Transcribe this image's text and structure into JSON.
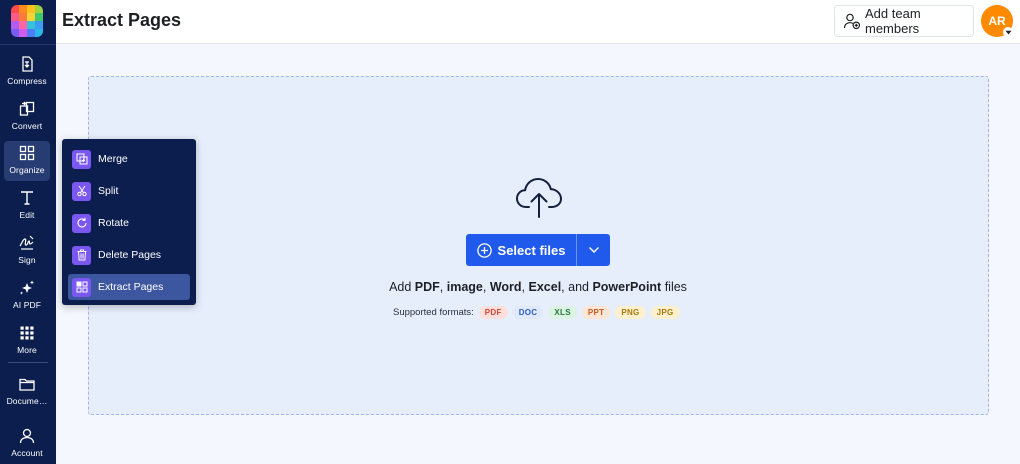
{
  "header": {
    "title": "Extract Pages",
    "team_button": "Add team members",
    "avatar_initials": "AR"
  },
  "sidebar": {
    "items": [
      {
        "label": "Compress",
        "icon": "compress-icon"
      },
      {
        "label": "Convert",
        "icon": "convert-icon"
      },
      {
        "label": "Organize",
        "icon": "grid-icon"
      },
      {
        "label": "Edit",
        "icon": "text-edit-icon"
      },
      {
        "label": "Sign",
        "icon": "signature-icon"
      },
      {
        "label": "AI PDF",
        "icon": "sparkle-icon"
      },
      {
        "label": "More",
        "icon": "dots-grid-icon"
      },
      {
        "label": "Docume…",
        "icon": "folder-icon"
      },
      {
        "label": "Account",
        "icon": "user-icon"
      }
    ]
  },
  "organize_menu": {
    "items": [
      {
        "label": "Merge",
        "icon": "merge-icon"
      },
      {
        "label": "Split",
        "icon": "scissors-icon"
      },
      {
        "label": "Rotate",
        "icon": "rotate-icon"
      },
      {
        "label": "Delete Pages",
        "icon": "trash-icon"
      },
      {
        "label": "Extract Pages",
        "icon": "extract-icon"
      }
    ],
    "active": "Extract Pages"
  },
  "dropzone": {
    "select_label": "Select files",
    "add_prefix": "Add ",
    "types": [
      "PDF",
      "image",
      "Word",
      "Excel",
      "PowerPoint"
    ],
    "sep_comma": ", ",
    "sep_and": ", and ",
    "add_suffix": " files",
    "formats_label": "Supported formats:",
    "formats": [
      {
        "name": "PDF",
        "bg": "#fde0dc",
        "fg": "#d0452f"
      },
      {
        "name": "DOC",
        "bg": "#dfe9fb",
        "fg": "#2d5fc1"
      },
      {
        "name": "XLS",
        "bg": "#dcf2e2",
        "fg": "#1f7a3f"
      },
      {
        "name": "PPT",
        "bg": "#fde6d6",
        "fg": "#c9591c"
      },
      {
        "name": "PNG",
        "bg": "#fdf0cf",
        "fg": "#a87a0c"
      },
      {
        "name": "JPG",
        "bg": "#fdf0cf",
        "fg": "#a87a0c"
      }
    ]
  },
  "colors": {
    "sidebar_bg": "#0b1e4d",
    "accent": "#1f5aec",
    "avatar": "#ff8a00",
    "menu_icon_bg": "#7a57f0"
  }
}
